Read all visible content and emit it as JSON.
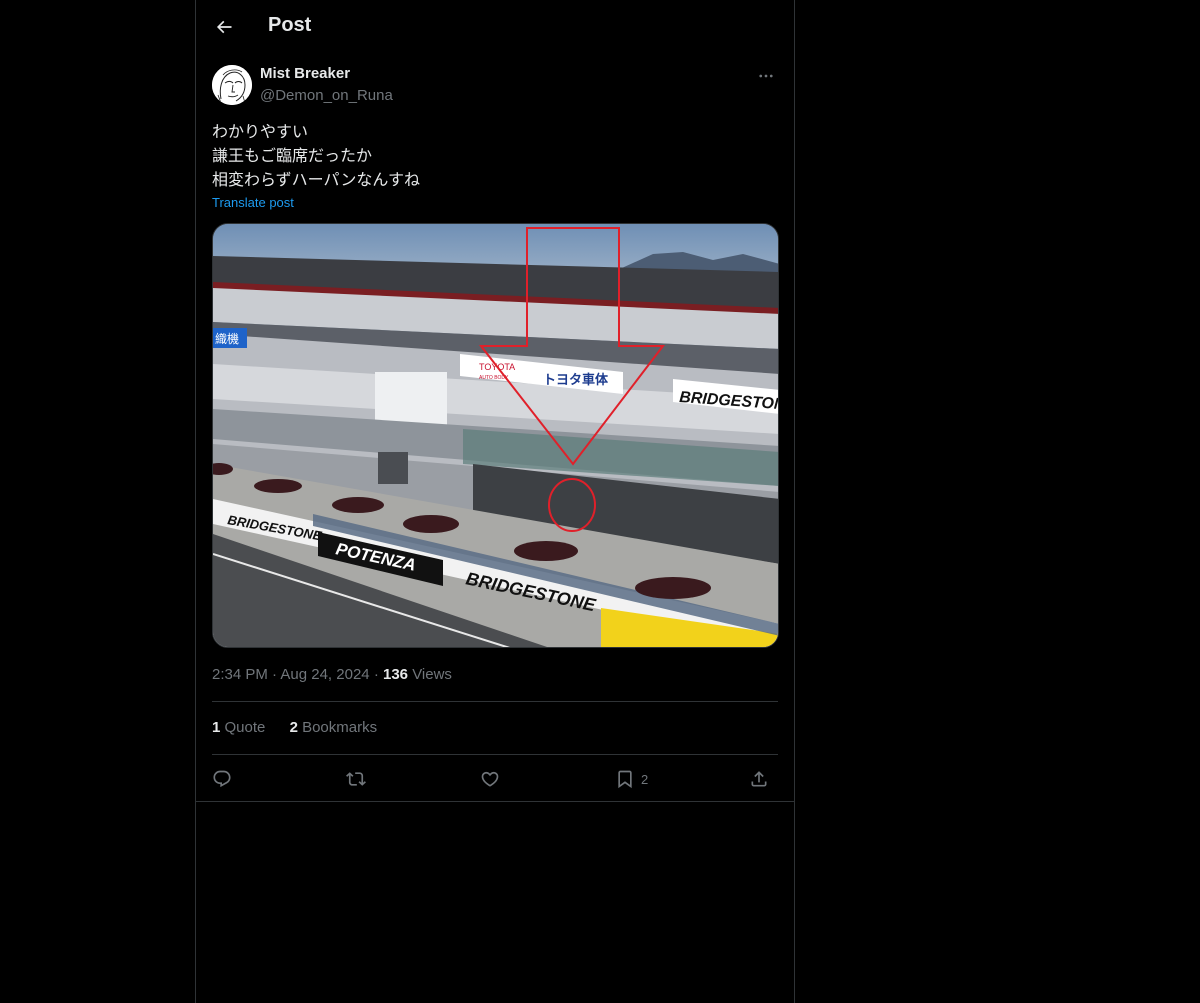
{
  "header": {
    "title": "Post"
  },
  "author": {
    "display_name": "Mist Breaker",
    "handle": "@Demon_on_Runa"
  },
  "post": {
    "lines": [
      "わかりやすい",
      "謙王もご臨席だったか",
      "相変わらずハーパンなんすね"
    ],
    "translate_label": "Translate post"
  },
  "image": {
    "signs": {
      "left_blue": "織機",
      "toyota_brand": "TOYOTA",
      "toyota_sub": "AUTO BODY",
      "toyota_jp": "トヨタ車体",
      "bridgestone_1": "BRIDGESTONE",
      "bridgestone_2": "BRIDGESTONE",
      "bridgestone_3": "BRIDGESTONE",
      "potenza": "POTENZA"
    }
  },
  "meta": {
    "time": "2:34 PM",
    "date": "Aug 24, 2024",
    "views_count": "136",
    "views_label": "Views",
    "separator": "·"
  },
  "stats": {
    "quotes_count": "1",
    "quotes_label": "Quote",
    "bookmarks_count": "2",
    "bookmarks_label": "Bookmarks"
  },
  "actions": {
    "bookmark_count": "2"
  },
  "colors": {
    "background": "#000000",
    "text": "#e7e9ea",
    "secondary": "#71767b",
    "link": "#1d9bf0",
    "border": "#2f3336",
    "annotation": "#e0202a"
  }
}
